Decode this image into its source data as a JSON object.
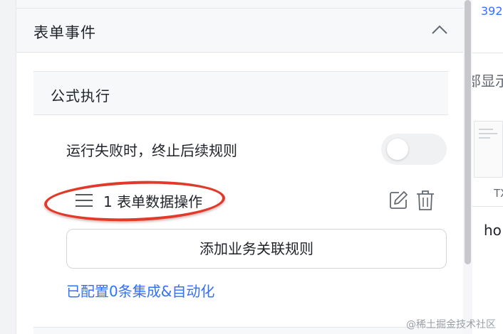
{
  "section": {
    "title": "表单事件"
  },
  "subsection": {
    "title": "公式执行"
  },
  "stop_on_failure": {
    "label": "运行失败时，终止后续规则",
    "enabled": false
  },
  "rules": [
    {
      "index": "1",
      "name": "表单数据操作"
    }
  ],
  "add_button": {
    "label": "添加业务关联规则"
  },
  "config_link": {
    "label": "已配置0条集成&自动化"
  },
  "background": {
    "number": "392",
    "text": "部显示",
    "thumb_label": "TXT",
    "word": "ho"
  },
  "watermark": "@稀土掘金技术社区",
  "colors": {
    "accent": "#3370ff",
    "highlight": "#e03a2b"
  },
  "icons": [
    "chevron-up-icon",
    "drag-handle-icon",
    "edit-icon",
    "trash-icon"
  ]
}
